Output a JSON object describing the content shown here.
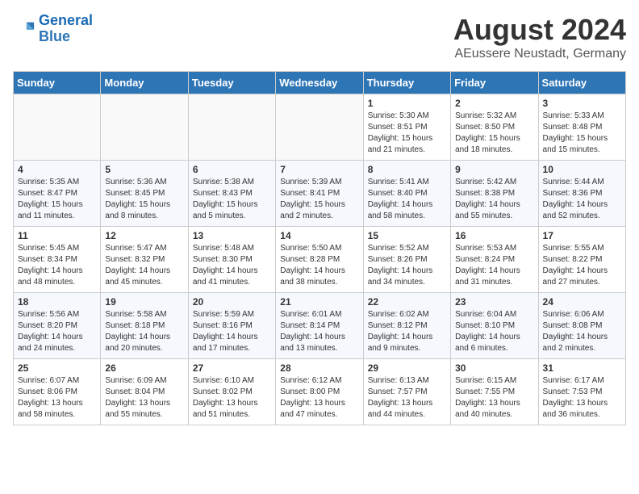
{
  "header": {
    "logo_line1": "General",
    "logo_line2": "Blue",
    "title": "August 2024",
    "subtitle": "AEussere Neustadt, Germany"
  },
  "weekdays": [
    "Sunday",
    "Monday",
    "Tuesday",
    "Wednesday",
    "Thursday",
    "Friday",
    "Saturday"
  ],
  "weeks": [
    [
      {
        "day": "",
        "info": ""
      },
      {
        "day": "",
        "info": ""
      },
      {
        "day": "",
        "info": ""
      },
      {
        "day": "",
        "info": ""
      },
      {
        "day": "1",
        "info": "Sunrise: 5:30 AM\nSunset: 8:51 PM\nDaylight: 15 hours\nand 21 minutes."
      },
      {
        "day": "2",
        "info": "Sunrise: 5:32 AM\nSunset: 8:50 PM\nDaylight: 15 hours\nand 18 minutes."
      },
      {
        "day": "3",
        "info": "Sunrise: 5:33 AM\nSunset: 8:48 PM\nDaylight: 15 hours\nand 15 minutes."
      }
    ],
    [
      {
        "day": "4",
        "info": "Sunrise: 5:35 AM\nSunset: 8:47 PM\nDaylight: 15 hours\nand 11 minutes."
      },
      {
        "day": "5",
        "info": "Sunrise: 5:36 AM\nSunset: 8:45 PM\nDaylight: 15 hours\nand 8 minutes."
      },
      {
        "day": "6",
        "info": "Sunrise: 5:38 AM\nSunset: 8:43 PM\nDaylight: 15 hours\nand 5 minutes."
      },
      {
        "day": "7",
        "info": "Sunrise: 5:39 AM\nSunset: 8:41 PM\nDaylight: 15 hours\nand 2 minutes."
      },
      {
        "day": "8",
        "info": "Sunrise: 5:41 AM\nSunset: 8:40 PM\nDaylight: 14 hours\nand 58 minutes."
      },
      {
        "day": "9",
        "info": "Sunrise: 5:42 AM\nSunset: 8:38 PM\nDaylight: 14 hours\nand 55 minutes."
      },
      {
        "day": "10",
        "info": "Sunrise: 5:44 AM\nSunset: 8:36 PM\nDaylight: 14 hours\nand 52 minutes."
      }
    ],
    [
      {
        "day": "11",
        "info": "Sunrise: 5:45 AM\nSunset: 8:34 PM\nDaylight: 14 hours\nand 48 minutes."
      },
      {
        "day": "12",
        "info": "Sunrise: 5:47 AM\nSunset: 8:32 PM\nDaylight: 14 hours\nand 45 minutes."
      },
      {
        "day": "13",
        "info": "Sunrise: 5:48 AM\nSunset: 8:30 PM\nDaylight: 14 hours\nand 41 minutes."
      },
      {
        "day": "14",
        "info": "Sunrise: 5:50 AM\nSunset: 8:28 PM\nDaylight: 14 hours\nand 38 minutes."
      },
      {
        "day": "15",
        "info": "Sunrise: 5:52 AM\nSunset: 8:26 PM\nDaylight: 14 hours\nand 34 minutes."
      },
      {
        "day": "16",
        "info": "Sunrise: 5:53 AM\nSunset: 8:24 PM\nDaylight: 14 hours\nand 31 minutes."
      },
      {
        "day": "17",
        "info": "Sunrise: 5:55 AM\nSunset: 8:22 PM\nDaylight: 14 hours\nand 27 minutes."
      }
    ],
    [
      {
        "day": "18",
        "info": "Sunrise: 5:56 AM\nSunset: 8:20 PM\nDaylight: 14 hours\nand 24 minutes."
      },
      {
        "day": "19",
        "info": "Sunrise: 5:58 AM\nSunset: 8:18 PM\nDaylight: 14 hours\nand 20 minutes."
      },
      {
        "day": "20",
        "info": "Sunrise: 5:59 AM\nSunset: 8:16 PM\nDaylight: 14 hours\nand 17 minutes."
      },
      {
        "day": "21",
        "info": "Sunrise: 6:01 AM\nSunset: 8:14 PM\nDaylight: 14 hours\nand 13 minutes."
      },
      {
        "day": "22",
        "info": "Sunrise: 6:02 AM\nSunset: 8:12 PM\nDaylight: 14 hours\nand 9 minutes."
      },
      {
        "day": "23",
        "info": "Sunrise: 6:04 AM\nSunset: 8:10 PM\nDaylight: 14 hours\nand 6 minutes."
      },
      {
        "day": "24",
        "info": "Sunrise: 6:06 AM\nSunset: 8:08 PM\nDaylight: 14 hours\nand 2 minutes."
      }
    ],
    [
      {
        "day": "25",
        "info": "Sunrise: 6:07 AM\nSunset: 8:06 PM\nDaylight: 13 hours\nand 58 minutes."
      },
      {
        "day": "26",
        "info": "Sunrise: 6:09 AM\nSunset: 8:04 PM\nDaylight: 13 hours\nand 55 minutes."
      },
      {
        "day": "27",
        "info": "Sunrise: 6:10 AM\nSunset: 8:02 PM\nDaylight: 13 hours\nand 51 minutes."
      },
      {
        "day": "28",
        "info": "Sunrise: 6:12 AM\nSunset: 8:00 PM\nDaylight: 13 hours\nand 47 minutes."
      },
      {
        "day": "29",
        "info": "Sunrise: 6:13 AM\nSunset: 7:57 PM\nDaylight: 13 hours\nand 44 minutes."
      },
      {
        "day": "30",
        "info": "Sunrise: 6:15 AM\nSunset: 7:55 PM\nDaylight: 13 hours\nand 40 minutes."
      },
      {
        "day": "31",
        "info": "Sunrise: 6:17 AM\nSunset: 7:53 PM\nDaylight: 13 hours\nand 36 minutes."
      }
    ]
  ]
}
